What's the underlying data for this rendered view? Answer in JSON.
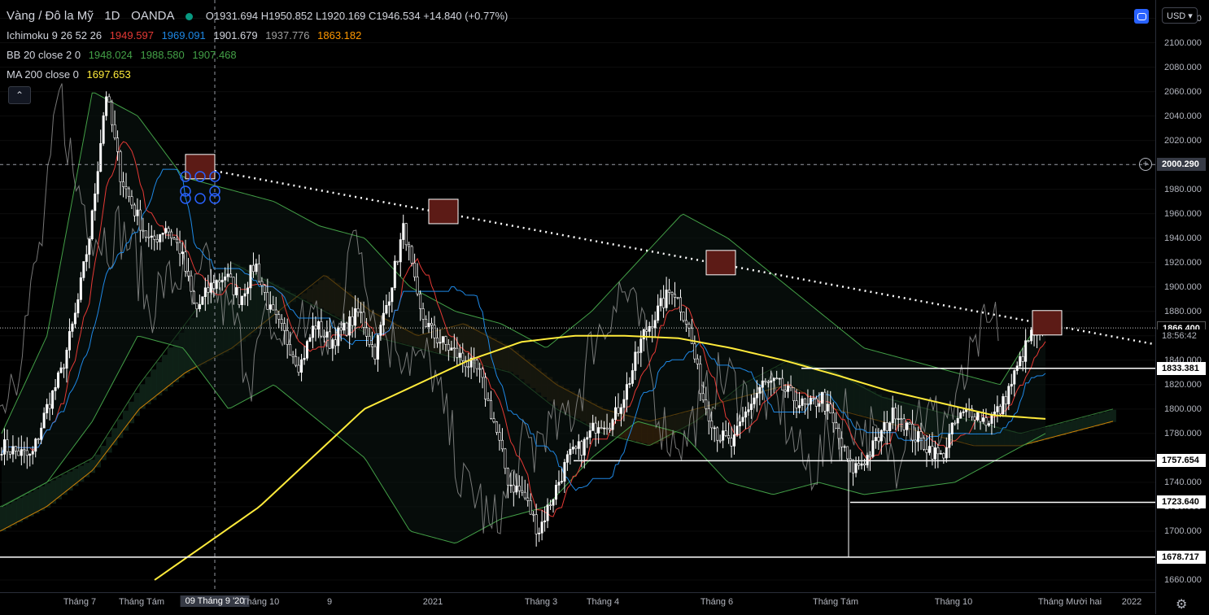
{
  "legend": {
    "symbol": "Vàng / Đô la Mỹ",
    "interval": "1D",
    "source": "OANDA",
    "ohlc": {
      "o": "1931.694",
      "h": "1950.852",
      "l": "1920.169",
      "c": "1946.534",
      "change": "+14.840 (+0.77%)"
    },
    "ichimoku": {
      "label": "Ichimoku 9 26 52 26",
      "v1": "1949.597",
      "v2": "1969.091",
      "v3": "1901.679",
      "v4": "1937.776",
      "v5": "1863.182"
    },
    "bb": {
      "label": "BB 20 close 2 0",
      "v1": "1948.024",
      "v2": "1988.580",
      "v3": "1907.468"
    },
    "ma": {
      "label": "MA 200 close 0",
      "v1": "1697.653"
    },
    "collapse_glyph": "⌃"
  },
  "toolbar": {
    "currency": "USD ▾"
  },
  "colors": {
    "up": "#ffffff",
    "ichi_tenkan": "#e53935",
    "ichi_kijun": "#1e88e5",
    "ichi_chikou": "#9e9e9e",
    "ichi_spanA": "#4caf50",
    "ichi_spanB": "#ff9800",
    "bb": "#43a047",
    "ma": "#ffeb3b",
    "trendline": "#ffffff",
    "highlight": "#5c1b16"
  },
  "chart_data": {
    "type": "candlestick",
    "symbol": "XAUUSD",
    "interval": "1D",
    "y_range": [
      1650,
      2135
    ],
    "y_ticks": [
      1660,
      1680,
      1700,
      1720,
      1740,
      1760,
      1780,
      1800,
      1820,
      1840,
      1860,
      1880,
      1900,
      1920,
      1940,
      1960,
      1980,
      2000,
      2020,
      2040,
      2060,
      2080,
      2100,
      2120
    ],
    "x_labels": [
      "Tháng 7",
      "Tháng Tám",
      "09 Tháng 9 '20",
      "Tháng 10",
      "9",
      "2021",
      "Tháng 3",
      "Tháng 4",
      "Tháng 6",
      "Tháng Tám",
      "Tháng 10",
      "Tháng Mười hai",
      "2022"
    ],
    "price_close_anchors": [
      1770,
      1765,
      1760,
      1800,
      1830,
      1880,
      1950,
      2060,
      1990,
      1960,
      1935,
      1950,
      1930,
      1880,
      1900,
      1910,
      1890,
      1920,
      1880,
      1860,
      1835,
      1870,
      1855,
      1865,
      1880,
      1845,
      1895,
      1950,
      1880,
      1860,
      1850,
      1840,
      1830,
      1790,
      1740,
      1730,
      1700,
      1730,
      1760,
      1770,
      1790,
      1790,
      1820,
      1860,
      1880,
      1900,
      1870,
      1810,
      1780,
      1770,
      1800,
      1820,
      1820,
      1810,
      1800,
      1810,
      1780,
      1750,
      1760,
      1780,
      1800,
      1780,
      1770,
      1760,
      1790,
      1800,
      1790,
      1800,
      1830,
      1860,
      1866
    ],
    "ma200_anchors": [
      1660,
      1690,
      1720,
      1760,
      1800,
      1820,
      1840,
      1855,
      1860,
      1860,
      1858,
      1850,
      1840,
      1828,
      1815,
      1805,
      1795,
      1792
    ],
    "bb_upper_anchors": [
      1780,
      1860,
      2060,
      2040,
      1990,
      1980,
      1970,
      1950,
      1940,
      1900,
      1880,
      1870,
      1850,
      1880,
      1920,
      1960,
      1940,
      1910,
      1880,
      1850,
      1840,
      1830,
      1820,
      1880
    ],
    "bb_lower_anchors": [
      1720,
      1740,
      1790,
      1860,
      1850,
      1800,
      1820,
      1790,
      1760,
      1700,
      1690,
      1710,
      1720,
      1760,
      1790,
      1780,
      1740,
      1730,
      1740,
      1730,
      1735,
      1740,
      1760,
      1780
    ],
    "cloud_a_anchors": [
      1720,
      1740,
      1760,
      1820,
      1870,
      1920,
      1900,
      1880,
      1860,
      1850,
      1840,
      1830,
      1800,
      1780,
      1770,
      1790,
      1820,
      1840,
      1830,
      1810,
      1800,
      1790,
      1780,
      1790,
      1800
    ],
    "cloud_b_anchors": [
      1700,
      1720,
      1750,
      1800,
      1830,
      1850,
      1880,
      1910,
      1880,
      1860,
      1870,
      1850,
      1820,
      1800,
      1790,
      1800,
      1810,
      1820,
      1800,
      1790,
      1780,
      1770,
      1770,
      1780,
      1790
    ],
    "trendline": {
      "from": {
        "label": "09 Tháng 9 '20",
        "price": 1995
      },
      "to_right_price": 1853
    },
    "pivot_highs": [
      1995,
      1960,
      1920,
      1880
    ],
    "horizontal_levels": [
      {
        "price": "1833.381",
        "value": 1833.381,
        "fg": "#000",
        "bg": "#fff"
      },
      {
        "price": "1757.654",
        "value": 1757.654,
        "fg": "#000",
        "bg": "#fff"
      },
      {
        "price": "1723.640",
        "value": 1723.64,
        "fg": "#000",
        "bg": "#fff"
      },
      {
        "price": "1678.717",
        "value": 1678.717,
        "fg": "#000",
        "bg": "#fff"
      }
    ],
    "crosshair": {
      "price": "2000.290",
      "value": 2000.29,
      "x_label": "09 Tháng 9 '20"
    },
    "last_price": {
      "price": "1866.400",
      "countdown": "18:56:42",
      "value": 1866.4
    }
  }
}
